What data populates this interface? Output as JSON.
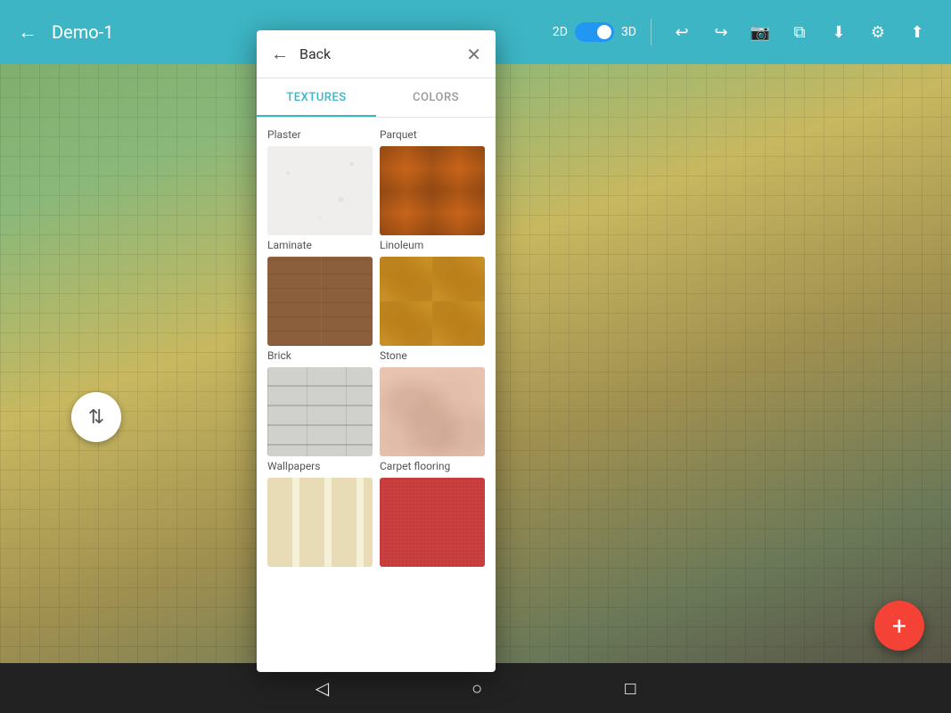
{
  "header": {
    "back_label": "←",
    "title": "Demo-1",
    "view_2d": "2D",
    "view_3d": "3D",
    "icons": {
      "undo": "↩",
      "redo": "↪",
      "camera": "📷",
      "layers": "⧉",
      "download": "⬇",
      "settings": "⚙",
      "share": "⬆"
    }
  },
  "modal": {
    "back_label": "←",
    "title": "Back",
    "close_label": "✕",
    "tabs": [
      {
        "id": "textures",
        "label": "TEXTURES",
        "active": true
      },
      {
        "id": "colors",
        "label": "COLORS",
        "active": false
      }
    ],
    "sections": [
      {
        "items": [
          {
            "id": "plaster",
            "label": "Plaster",
            "texture_class": "texture-plaster"
          },
          {
            "id": "parquet",
            "label": "Parquet",
            "texture_class": "texture-parquet"
          }
        ]
      },
      {
        "items": [
          {
            "id": "laminate",
            "label": "Laminate",
            "texture_class": "texture-laminate"
          },
          {
            "id": "linoleum",
            "label": "Linoleum",
            "texture_class": "texture-linoleum"
          }
        ]
      },
      {
        "items": [
          {
            "id": "brick",
            "label": "Brick",
            "texture_class": "texture-brick"
          },
          {
            "id": "stone",
            "label": "Stone",
            "texture_class": "texture-stone"
          }
        ]
      },
      {
        "items": [
          {
            "id": "wallpapers",
            "label": "Wallpapers",
            "texture_class": "texture-wallpapers"
          },
          {
            "id": "carpet",
            "label": "Carpet flooring",
            "texture_class": "texture-carpet"
          }
        ]
      }
    ]
  },
  "float_btn": {
    "icon": "⇅"
  },
  "fab": {
    "icon": "+"
  },
  "bottom_nav": {
    "back_icon": "◁",
    "home_icon": "○",
    "recents_icon": "□"
  }
}
